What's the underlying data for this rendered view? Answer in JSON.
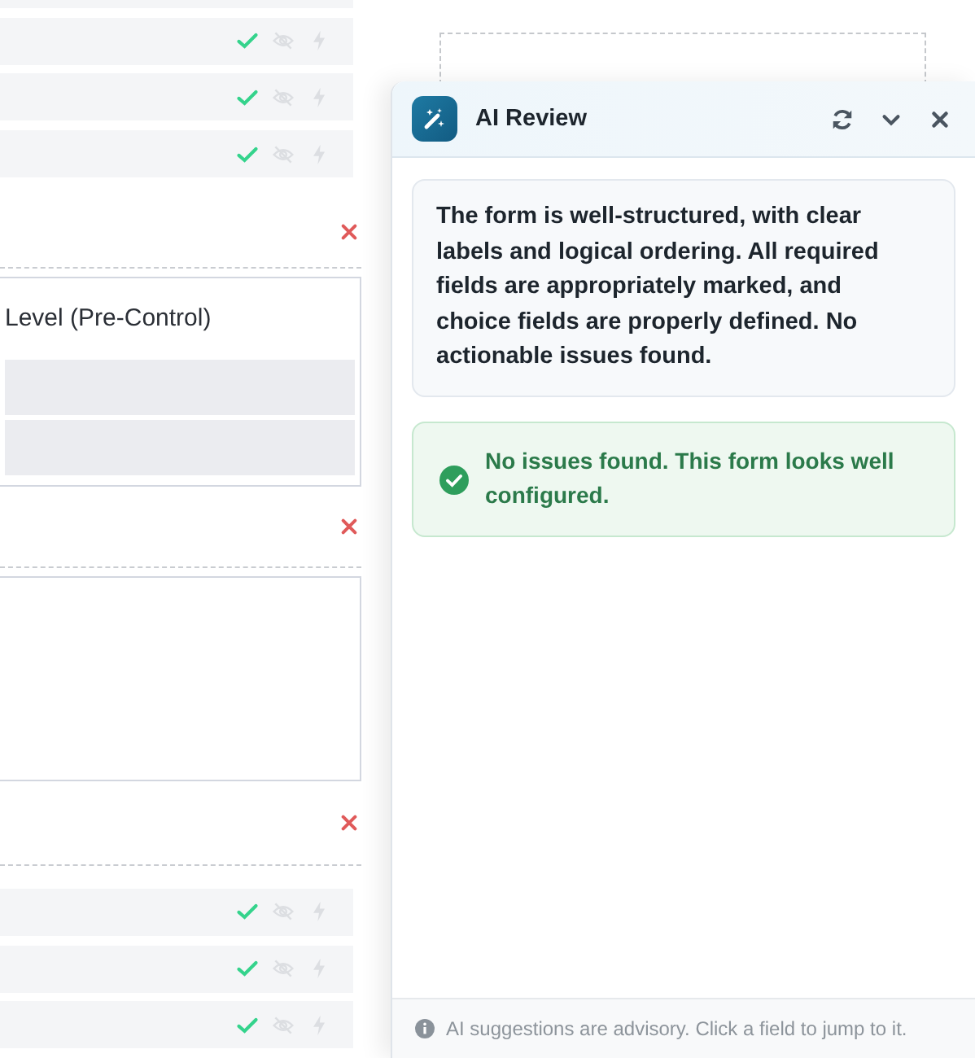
{
  "form": {
    "blocks": [
      {
        "kind": "row-edge"
      },
      {
        "kind": "row",
        "valid": true,
        "hidden": false,
        "logic": false
      },
      {
        "kind": "row",
        "valid": true,
        "hidden": false,
        "logic": false
      },
      {
        "kind": "row",
        "valid": true,
        "hidden": false,
        "logic": false
      },
      {
        "kind": "choice",
        "label": "Level (Pre-Control)"
      },
      {
        "kind": "text"
      },
      {
        "kind": "header"
      },
      {
        "kind": "row",
        "valid": true,
        "hidden": false,
        "logic": false
      },
      {
        "kind": "row",
        "valid": true,
        "hidden": false,
        "logic": false
      },
      {
        "kind": "row",
        "valid": true,
        "hidden": false,
        "logic": false
      }
    ]
  },
  "ai_review": {
    "title": "AI Review",
    "summary": "The form is well-structured, with clear labels and logical ordering. All required fields are appropriately marked, and choice fields are properly defined. No actionable issues found.",
    "result": {
      "kind": "success",
      "text": "No issues found. This form looks well configured."
    },
    "footer": "AI suggestions are advisory. Click a field to jump to it."
  }
}
